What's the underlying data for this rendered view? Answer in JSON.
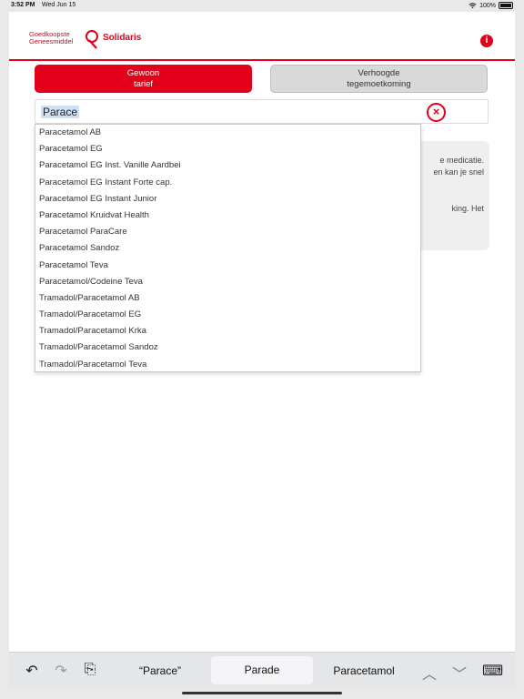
{
  "status_bar": {
    "time": "3:52 PM",
    "date": "Wed Jun 15",
    "battery": "100%"
  },
  "header": {
    "logo_line1": "Goedkoopste",
    "logo_line2": "Geneesmiddel",
    "brand": "Solidaris",
    "info_icon": "i"
  },
  "tabs": [
    {
      "line1": "Gewoon",
      "line2": "tarief",
      "active": true
    },
    {
      "line1": "Verhoogde",
      "line2": "tegemoetkoming",
      "active": false
    }
  ],
  "search": {
    "value": "Parace",
    "clear_icon": "×"
  },
  "card_partial": {
    "line1": "e medicatie.",
    "line2": "en kan je snel",
    "line3": "king. Het"
  },
  "suggestions": [
    "Paracetamol AB",
    "Paracetamol EG",
    "Paracetamol EG Inst. Vanille Aardbei",
    "Paracetamol EG Instant Forte cap.",
    "Paracetamol EG Instant Junior",
    "Paracetamol Kruidvat Health",
    "Paracetamol ParaCare",
    "Paracetamol Sandoz",
    "Paracetamol Teva",
    "Paracetamol/Codeine Teva",
    "Tramadol/Paracetamol AB",
    "Tramadol/Paracetamol EG",
    "Tramadol/Paracetamol Krka",
    "Tramadol/Paracetamol Sandoz",
    "Tramadol/Paracetamol Teva"
  ],
  "keyboard_bar": {
    "undo_icon": "↶",
    "redo_icon": "↷",
    "paste_icon": "⎘",
    "suggestion_left": "“Parace”",
    "suggestion_mid": "Parade",
    "suggestion_right": "Paracetamol",
    "up_icon": "︿",
    "down_icon": "﹀",
    "keyboard_icon": "⌨"
  },
  "colors": {
    "brand_red": "#e2001a"
  }
}
